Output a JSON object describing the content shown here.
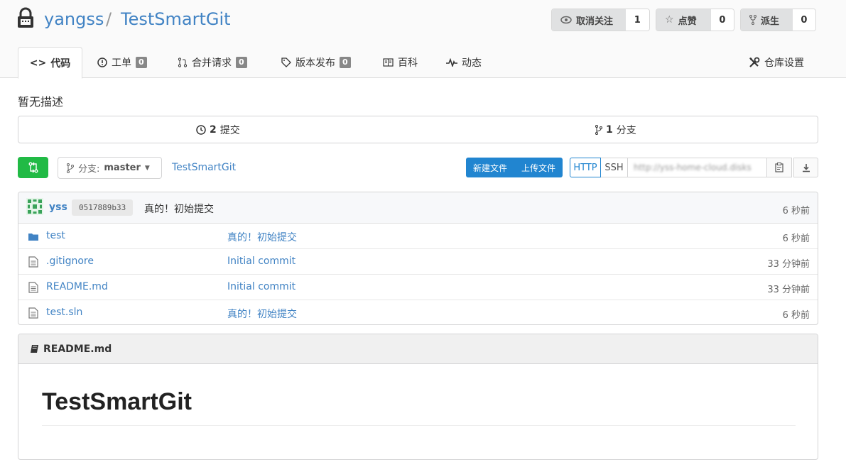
{
  "repo": {
    "owner": "yangss",
    "separator": "/",
    "name": "TestSmartGit"
  },
  "actions": {
    "watch": {
      "label": "取消关注",
      "count": "1",
      "icon": "eye-icon"
    },
    "star": {
      "label": "点赞",
      "count": "0",
      "icon": "star-icon"
    },
    "fork": {
      "label": "派生",
      "count": "0",
      "icon": "fork-icon"
    }
  },
  "tabs": [
    {
      "label": "代码",
      "icon": "code-icon"
    },
    {
      "label": "工单",
      "badge": "0",
      "icon": "issue-icon"
    },
    {
      "label": "合并请求",
      "badge": "0",
      "icon": "pull-request-icon"
    },
    {
      "label": "版本发布",
      "badge": "0",
      "icon": "tag-icon"
    },
    {
      "label": "百科",
      "icon": "book-icon"
    },
    {
      "label": "动态",
      "icon": "pulse-icon"
    },
    {
      "label": "仓库设置",
      "icon": "tools-icon"
    }
  ],
  "description": "暂无描述",
  "stats": {
    "commits_count": "2",
    "commits_label": "提交",
    "branches_count": "1",
    "branches_label": "分支"
  },
  "toolbar": {
    "branch_prefix": "分支:",
    "branch": "master",
    "path": "TestSmartGit",
    "new_file": "新建文件",
    "upload_file": "上传文件",
    "http": "HTTP",
    "ssh": "SSH",
    "clone_url": "http://yss-home-cloud.disks"
  },
  "latest_commit": {
    "user": "yss",
    "sha": "0517889b33",
    "message": "真的！初始提交",
    "age": "6 秒前"
  },
  "files": [
    {
      "name": "test",
      "type": "folder",
      "message": "真的！初始提交",
      "age": "6 秒前"
    },
    {
      "name": ".gitignore",
      "type": "file",
      "message": "Initial commit",
      "age": "33 分钟前"
    },
    {
      "name": "README.md",
      "type": "file",
      "message": "Initial commit",
      "age": "33 分钟前"
    },
    {
      "name": "test.sln",
      "type": "file",
      "message": "真的！初始提交",
      "age": "6 秒前"
    }
  ],
  "readme": {
    "filename": "README.md",
    "heading": "TestSmartGit"
  },
  "colors": {
    "link": "#4183c4",
    "primary": "#2185d0",
    "green": "#21ba45"
  }
}
